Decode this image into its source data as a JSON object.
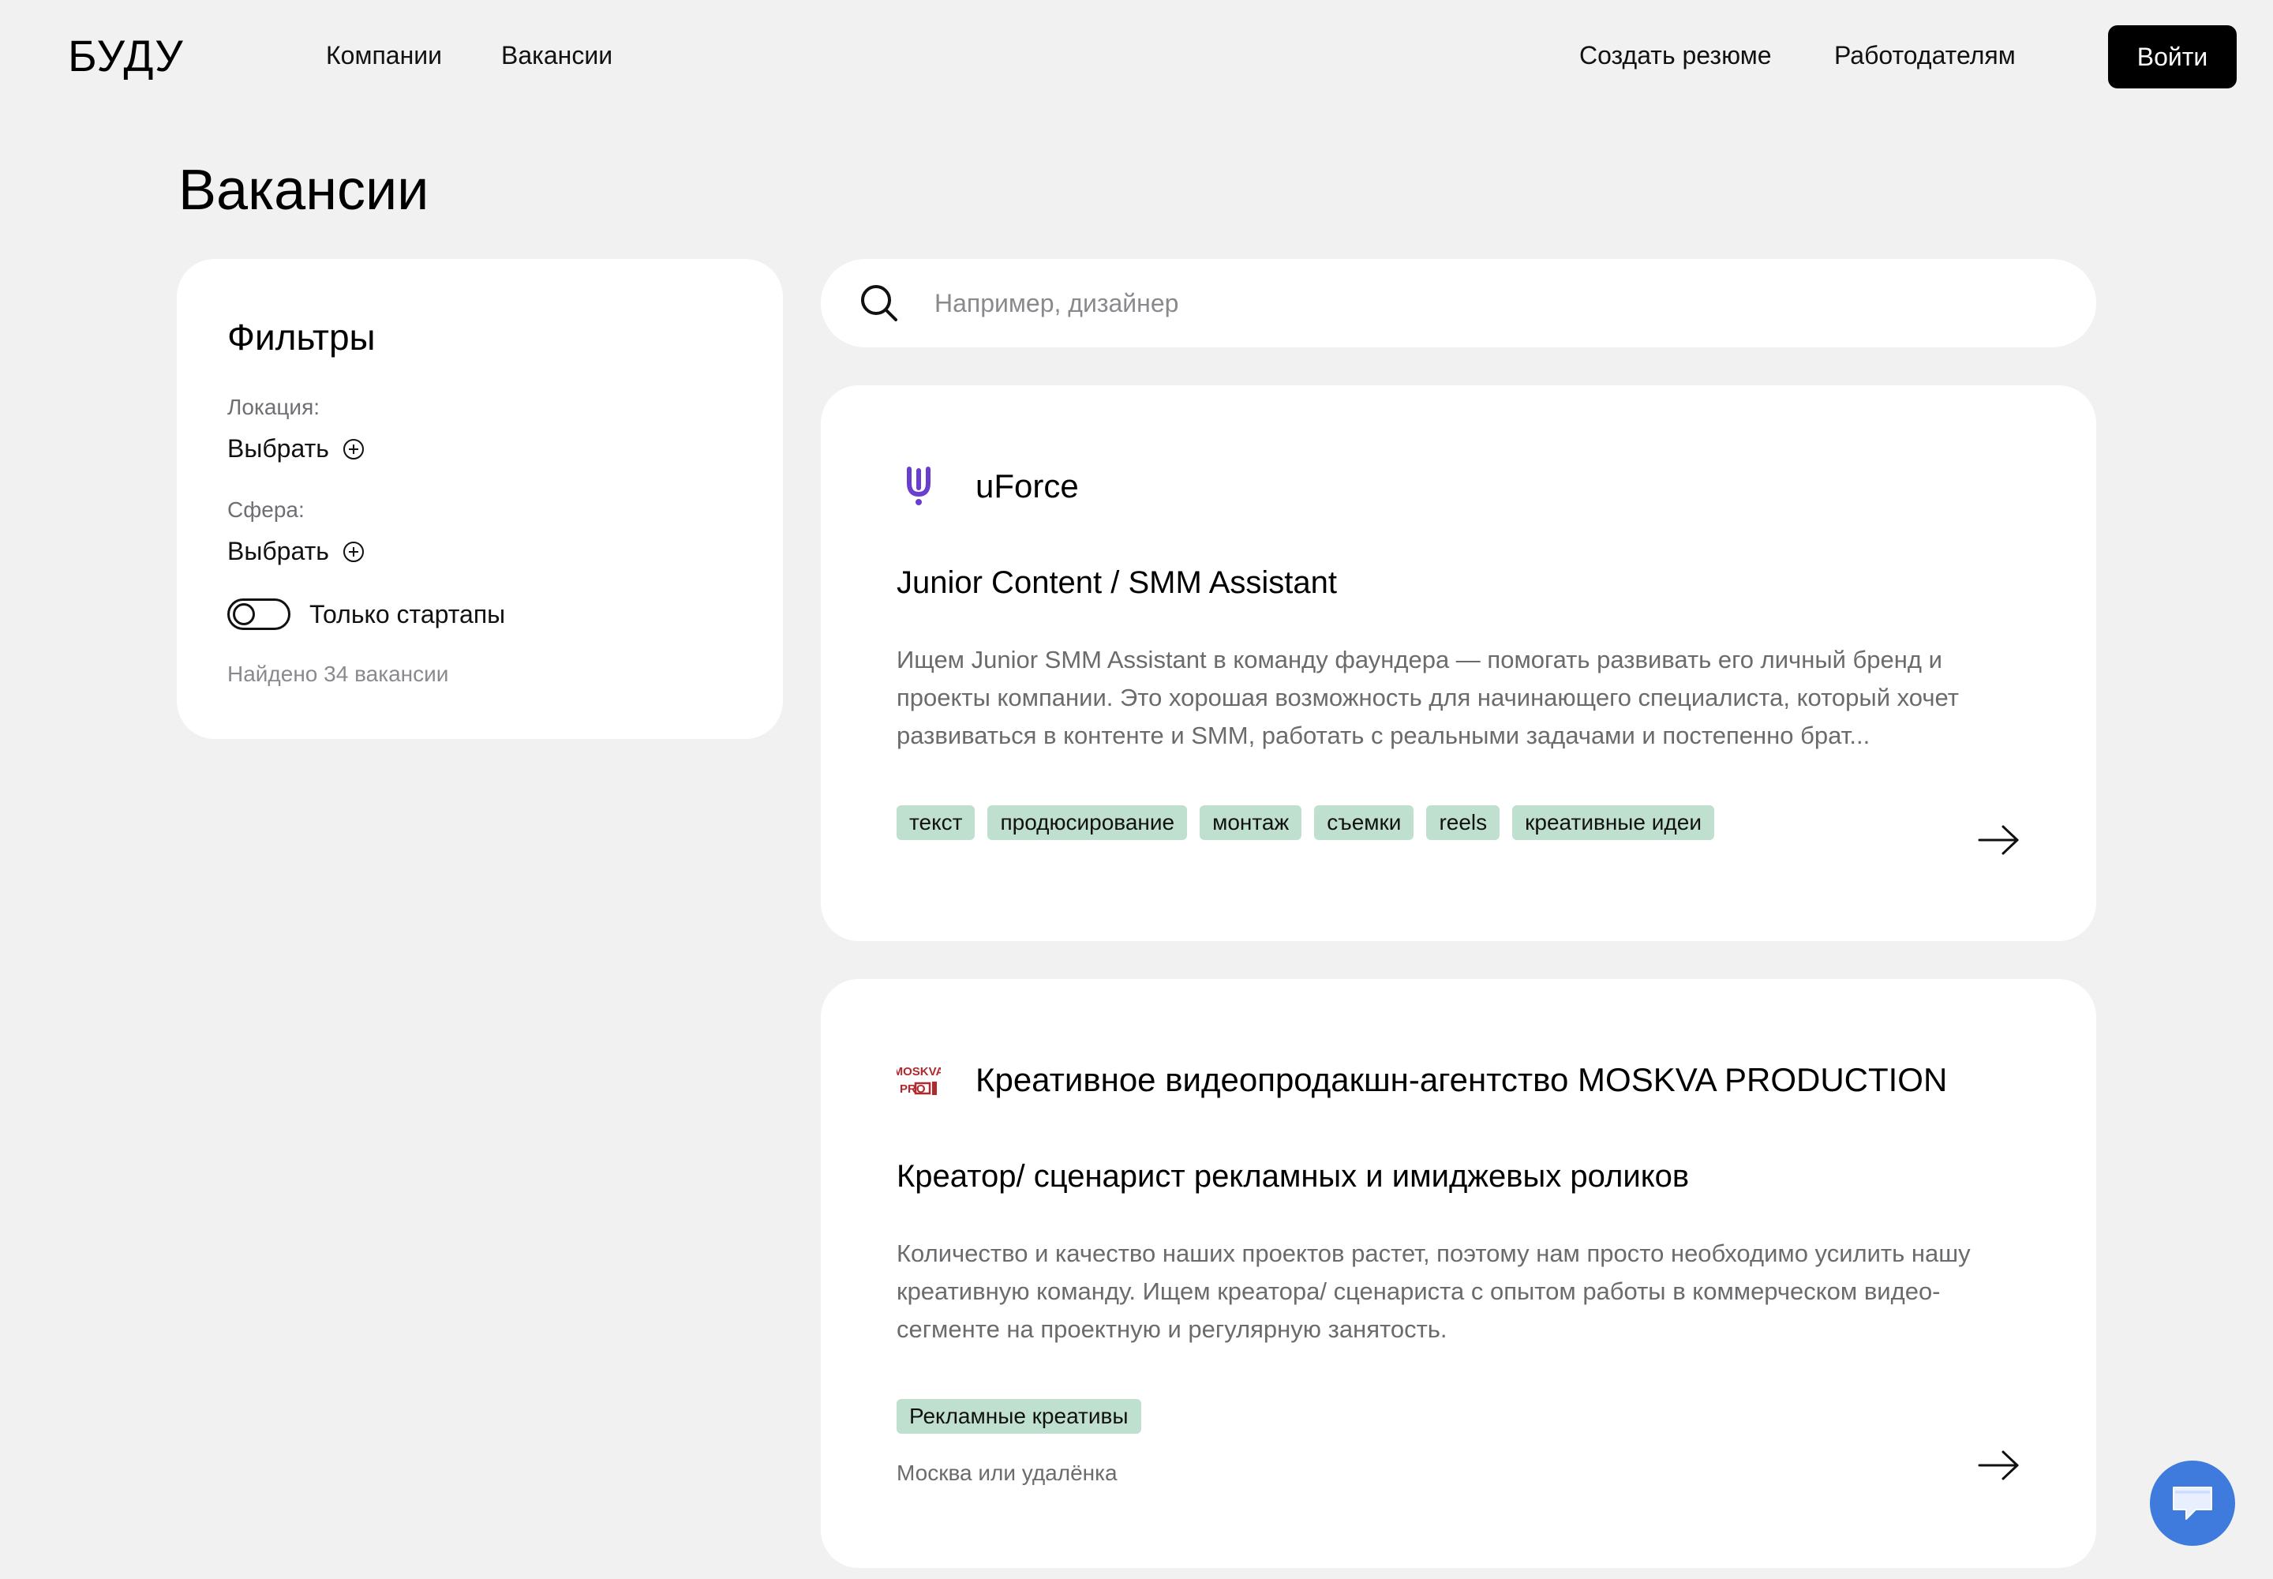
{
  "header": {
    "logo": "БУДУ",
    "nav": [
      "Компании",
      "Вакансии"
    ],
    "right_links": [
      "Создать резюме",
      "Работодателям"
    ],
    "login_label": "Войти"
  },
  "page_title": "Вакансии",
  "filters": {
    "title": "Фильтры",
    "location_label": "Локация:",
    "location_choose": "Выбрать",
    "sphere_label": "Сфера:",
    "sphere_choose": "Выбрать",
    "startups_label": "Только стартапы",
    "startups_on": false,
    "found_text": "Найдено 34 вакансии"
  },
  "search": {
    "placeholder": "Например, дизайнер",
    "value": ""
  },
  "jobs": [
    {
      "company": "uForce",
      "title": "Junior Content / SMM Assistant",
      "description": "Ищем Junior SMM Assistant в команду фаундера — помогать развивать его личный бренд и проекты компании. Это хорошая возможность для начинающего специалиста, который хочет развиваться в контенте и SMM, работать с реальными задачами и постепенно брат...",
      "tags": [
        "текст",
        "продюсирование",
        "монтаж",
        "съемки",
        "reels",
        "креативные идеи"
      ]
    },
    {
      "company": "Креативное видеопродакшн-агентство MOSKVA PRODUCTION",
      "title": "Креатор/ сценарист рекламных и имиджевых роликов",
      "description": "Количество и качество наших проектов растет, поэтому нам просто необходимо усилить нашу креативную команду. Ищем креатора/ сценариста с опытом работы в коммерческом видео-сегменте на проектную и регулярную занятость.",
      "tags": [
        "Рекламные креативы"
      ],
      "location": "Москва или удалёнка",
      "logo_text": [
        "MOSKVA",
        "PRO"
      ]
    }
  ],
  "colors": {
    "background": "#f1f1f2",
    "tag": "#bfe0cf",
    "accent_uforce": "#6a3fd0",
    "accent_moskva": "#b3282d",
    "chat": "#3f7bdc"
  }
}
